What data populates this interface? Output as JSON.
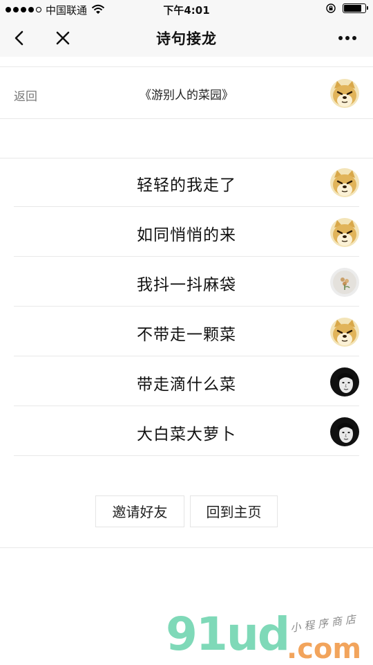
{
  "status_bar": {
    "carrier": "中国联通",
    "time": "下午4:01",
    "signal_bars_filled": 4,
    "signal_bars_total": 5,
    "battery_level": 0.85
  },
  "nav": {
    "title": "诗句接龙",
    "back_icon": "chevron-left-icon",
    "close_icon": "close-icon",
    "more_icon": "more-dots-icon"
  },
  "header": {
    "back_label": "返回",
    "poem_title": "《游别人的菜园》"
  },
  "verses": [
    {
      "text": "轻轻的我走了",
      "avatar": "doge"
    },
    {
      "text": "如同悄悄的来",
      "avatar": "doge"
    },
    {
      "text": "我抖一抖麻袋",
      "avatar": "flower"
    },
    {
      "text": "不带走一颗菜",
      "avatar": "doge"
    },
    {
      "text": "带走滴什么菜",
      "avatar": "man"
    },
    {
      "text": "大白菜大萝卜",
      "avatar": "man"
    }
  ],
  "actions": {
    "invite_label": "邀请好友",
    "home_label": "回到主页"
  },
  "watermark": {
    "brand": "91ud",
    "domain": ".com",
    "tagline": "小程序商店"
  }
}
